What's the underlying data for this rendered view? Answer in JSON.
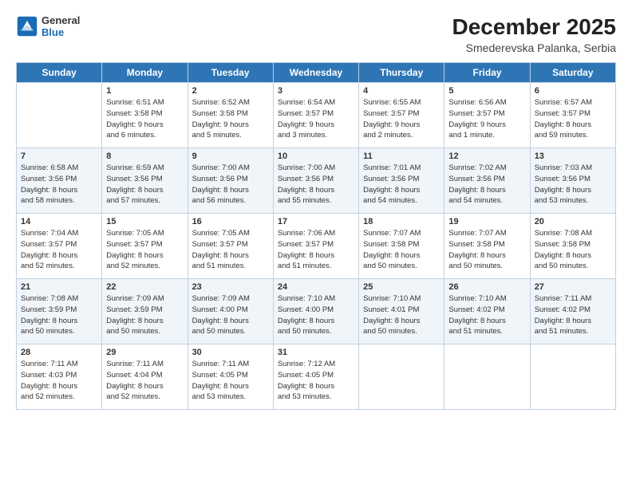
{
  "logo": {
    "line1": "General",
    "line2": "Blue"
  },
  "title": "December 2025",
  "subtitle": "Smederevska Palanka, Serbia",
  "headers": [
    "Sunday",
    "Monday",
    "Tuesday",
    "Wednesday",
    "Thursday",
    "Friday",
    "Saturday"
  ],
  "weeks": [
    [
      {
        "day": "",
        "info": ""
      },
      {
        "day": "1",
        "info": "Sunrise: 6:51 AM\nSunset: 3:58 PM\nDaylight: 9 hours\nand 6 minutes."
      },
      {
        "day": "2",
        "info": "Sunrise: 6:52 AM\nSunset: 3:58 PM\nDaylight: 9 hours\nand 5 minutes."
      },
      {
        "day": "3",
        "info": "Sunrise: 6:54 AM\nSunset: 3:57 PM\nDaylight: 9 hours\nand 3 minutes."
      },
      {
        "day": "4",
        "info": "Sunrise: 6:55 AM\nSunset: 3:57 PM\nDaylight: 9 hours\nand 2 minutes."
      },
      {
        "day": "5",
        "info": "Sunrise: 6:56 AM\nSunset: 3:57 PM\nDaylight: 9 hours\nand 1 minute."
      },
      {
        "day": "6",
        "info": "Sunrise: 6:57 AM\nSunset: 3:57 PM\nDaylight: 8 hours\nand 59 minutes."
      }
    ],
    [
      {
        "day": "7",
        "info": "Sunrise: 6:58 AM\nSunset: 3:56 PM\nDaylight: 8 hours\nand 58 minutes."
      },
      {
        "day": "8",
        "info": "Sunrise: 6:59 AM\nSunset: 3:56 PM\nDaylight: 8 hours\nand 57 minutes."
      },
      {
        "day": "9",
        "info": "Sunrise: 7:00 AM\nSunset: 3:56 PM\nDaylight: 8 hours\nand 56 minutes."
      },
      {
        "day": "10",
        "info": "Sunrise: 7:00 AM\nSunset: 3:56 PM\nDaylight: 8 hours\nand 55 minutes."
      },
      {
        "day": "11",
        "info": "Sunrise: 7:01 AM\nSunset: 3:56 PM\nDaylight: 8 hours\nand 54 minutes."
      },
      {
        "day": "12",
        "info": "Sunrise: 7:02 AM\nSunset: 3:56 PM\nDaylight: 8 hours\nand 54 minutes."
      },
      {
        "day": "13",
        "info": "Sunrise: 7:03 AM\nSunset: 3:56 PM\nDaylight: 8 hours\nand 53 minutes."
      }
    ],
    [
      {
        "day": "14",
        "info": "Sunrise: 7:04 AM\nSunset: 3:57 PM\nDaylight: 8 hours\nand 52 minutes."
      },
      {
        "day": "15",
        "info": "Sunrise: 7:05 AM\nSunset: 3:57 PM\nDaylight: 8 hours\nand 52 minutes."
      },
      {
        "day": "16",
        "info": "Sunrise: 7:05 AM\nSunset: 3:57 PM\nDaylight: 8 hours\nand 51 minutes."
      },
      {
        "day": "17",
        "info": "Sunrise: 7:06 AM\nSunset: 3:57 PM\nDaylight: 8 hours\nand 51 minutes."
      },
      {
        "day": "18",
        "info": "Sunrise: 7:07 AM\nSunset: 3:58 PM\nDaylight: 8 hours\nand 50 minutes."
      },
      {
        "day": "19",
        "info": "Sunrise: 7:07 AM\nSunset: 3:58 PM\nDaylight: 8 hours\nand 50 minutes."
      },
      {
        "day": "20",
        "info": "Sunrise: 7:08 AM\nSunset: 3:58 PM\nDaylight: 8 hours\nand 50 minutes."
      }
    ],
    [
      {
        "day": "21",
        "info": "Sunrise: 7:08 AM\nSunset: 3:59 PM\nDaylight: 8 hours\nand 50 minutes."
      },
      {
        "day": "22",
        "info": "Sunrise: 7:09 AM\nSunset: 3:59 PM\nDaylight: 8 hours\nand 50 minutes."
      },
      {
        "day": "23",
        "info": "Sunrise: 7:09 AM\nSunset: 4:00 PM\nDaylight: 8 hours\nand 50 minutes."
      },
      {
        "day": "24",
        "info": "Sunrise: 7:10 AM\nSunset: 4:00 PM\nDaylight: 8 hours\nand 50 minutes."
      },
      {
        "day": "25",
        "info": "Sunrise: 7:10 AM\nSunset: 4:01 PM\nDaylight: 8 hours\nand 50 minutes."
      },
      {
        "day": "26",
        "info": "Sunrise: 7:10 AM\nSunset: 4:02 PM\nDaylight: 8 hours\nand 51 minutes."
      },
      {
        "day": "27",
        "info": "Sunrise: 7:11 AM\nSunset: 4:02 PM\nDaylight: 8 hours\nand 51 minutes."
      }
    ],
    [
      {
        "day": "28",
        "info": "Sunrise: 7:11 AM\nSunset: 4:03 PM\nDaylight: 8 hours\nand 52 minutes."
      },
      {
        "day": "29",
        "info": "Sunrise: 7:11 AM\nSunset: 4:04 PM\nDaylight: 8 hours\nand 52 minutes."
      },
      {
        "day": "30",
        "info": "Sunrise: 7:11 AM\nSunset: 4:05 PM\nDaylight: 8 hours\nand 53 minutes."
      },
      {
        "day": "31",
        "info": "Sunrise: 7:12 AM\nSunset: 4:05 PM\nDaylight: 8 hours\nand 53 minutes."
      },
      {
        "day": "",
        "info": ""
      },
      {
        "day": "",
        "info": ""
      },
      {
        "day": "",
        "info": ""
      }
    ]
  ]
}
